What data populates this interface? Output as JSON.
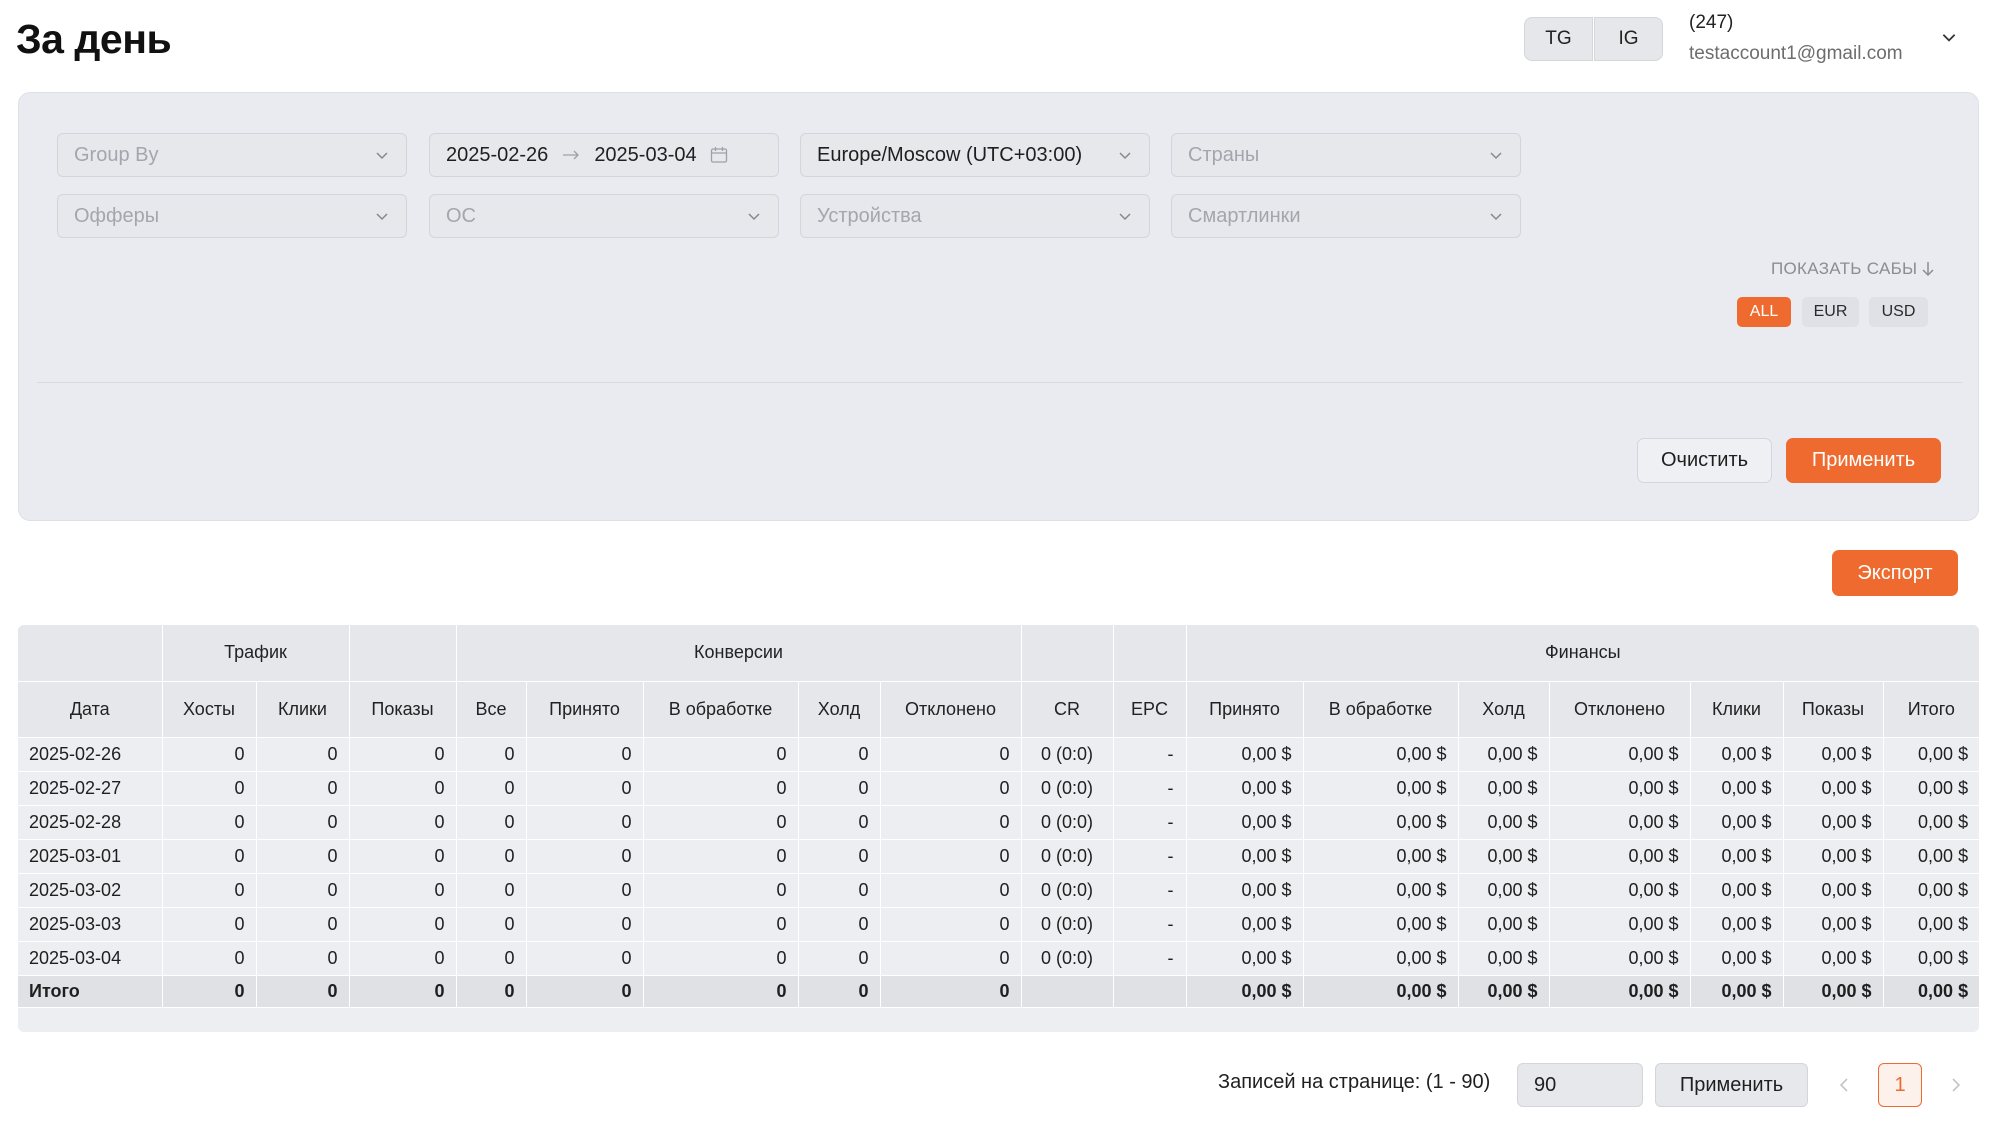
{
  "header": {
    "title": "За день",
    "toggles": [
      "TG",
      "IG"
    ],
    "account_count": "(247)",
    "account_email": "testaccount1@gmail.com"
  },
  "filters": {
    "group_by_placeholder": "Group By",
    "date_from": "2025-02-26",
    "date_to": "2025-03-04",
    "timezone": "Europe/Moscow (UTC+03:00)",
    "countries_placeholder": "Страны",
    "offers_placeholder": "Офферы",
    "os_placeholder": "ОС",
    "devices_placeholder": "Устройства",
    "smartlinks_placeholder": "Смартлинки",
    "show_subs": "ПОКАЗАТЬ САБЫ",
    "currencies": [
      "ALL",
      "EUR",
      "USD"
    ],
    "selected_currency": "ALL",
    "clear_label": "Очистить",
    "apply_label": "Применить"
  },
  "export_label": "Экспорт",
  "table": {
    "groups": {
      "traffic": "Трафик",
      "conversions": "Конверсии",
      "finance": "Финансы"
    },
    "columns": [
      "Дата",
      "Хосты",
      "Клики",
      "Показы",
      "Все",
      "Принято",
      "В обработке",
      "Холд",
      "Отклонено",
      "CR",
      "EPC",
      "Принято",
      "В обработке",
      "Холд",
      "Отклонено",
      "Клики",
      "Показы",
      "Итого"
    ],
    "rows": [
      [
        "2025-02-26",
        "0",
        "0",
        "0",
        "0",
        "0",
        "0",
        "0",
        "0",
        "0 (0:0)",
        "-",
        "0,00 $",
        "0,00 $",
        "0,00 $",
        "0,00 $",
        "0,00 $",
        "0,00 $",
        "0,00 $"
      ],
      [
        "2025-02-27",
        "0",
        "0",
        "0",
        "0",
        "0",
        "0",
        "0",
        "0",
        "0 (0:0)",
        "-",
        "0,00 $",
        "0,00 $",
        "0,00 $",
        "0,00 $",
        "0,00 $",
        "0,00 $",
        "0,00 $"
      ],
      [
        "2025-02-28",
        "0",
        "0",
        "0",
        "0",
        "0",
        "0",
        "0",
        "0",
        "0 (0:0)",
        "-",
        "0,00 $",
        "0,00 $",
        "0,00 $",
        "0,00 $",
        "0,00 $",
        "0,00 $",
        "0,00 $"
      ],
      [
        "2025-03-01",
        "0",
        "0",
        "0",
        "0",
        "0",
        "0",
        "0",
        "0",
        "0 (0:0)",
        "-",
        "0,00 $",
        "0,00 $",
        "0,00 $",
        "0,00 $",
        "0,00 $",
        "0,00 $",
        "0,00 $"
      ],
      [
        "2025-03-02",
        "0",
        "0",
        "0",
        "0",
        "0",
        "0",
        "0",
        "0",
        "0 (0:0)",
        "-",
        "0,00 $",
        "0,00 $",
        "0,00 $",
        "0,00 $",
        "0,00 $",
        "0,00 $",
        "0,00 $"
      ],
      [
        "2025-03-03",
        "0",
        "0",
        "0",
        "0",
        "0",
        "0",
        "0",
        "0",
        "0 (0:0)",
        "-",
        "0,00 $",
        "0,00 $",
        "0,00 $",
        "0,00 $",
        "0,00 $",
        "0,00 $",
        "0,00 $"
      ],
      [
        "2025-03-04",
        "0",
        "0",
        "0",
        "0",
        "0",
        "0",
        "0",
        "0",
        "0 (0:0)",
        "-",
        "0,00 $",
        "0,00 $",
        "0,00 $",
        "0,00 $",
        "0,00 $",
        "0,00 $",
        "0,00 $"
      ]
    ],
    "total": [
      "Итого",
      "0",
      "0",
      "0",
      "0",
      "0",
      "0",
      "0",
      "0",
      "",
      "",
      "0,00 $",
      "0,00 $",
      "0,00 $",
      "0,00 $",
      "0,00 $",
      "0,00 $",
      "0,00 $"
    ]
  },
  "pagination": {
    "label": "Записей на странице: (1 - 90)",
    "per_page": "90",
    "apply_label": "Применить",
    "current_page": "1"
  },
  "colors": {
    "accent": "#ee6a2e",
    "panel_bg": "#e9ebf0"
  },
  "icons": [
    "chevron-down-icon",
    "arrow-right-icon",
    "calendar-icon",
    "arrow-down-icon",
    "chevron-left-icon",
    "chevron-right-icon"
  ]
}
